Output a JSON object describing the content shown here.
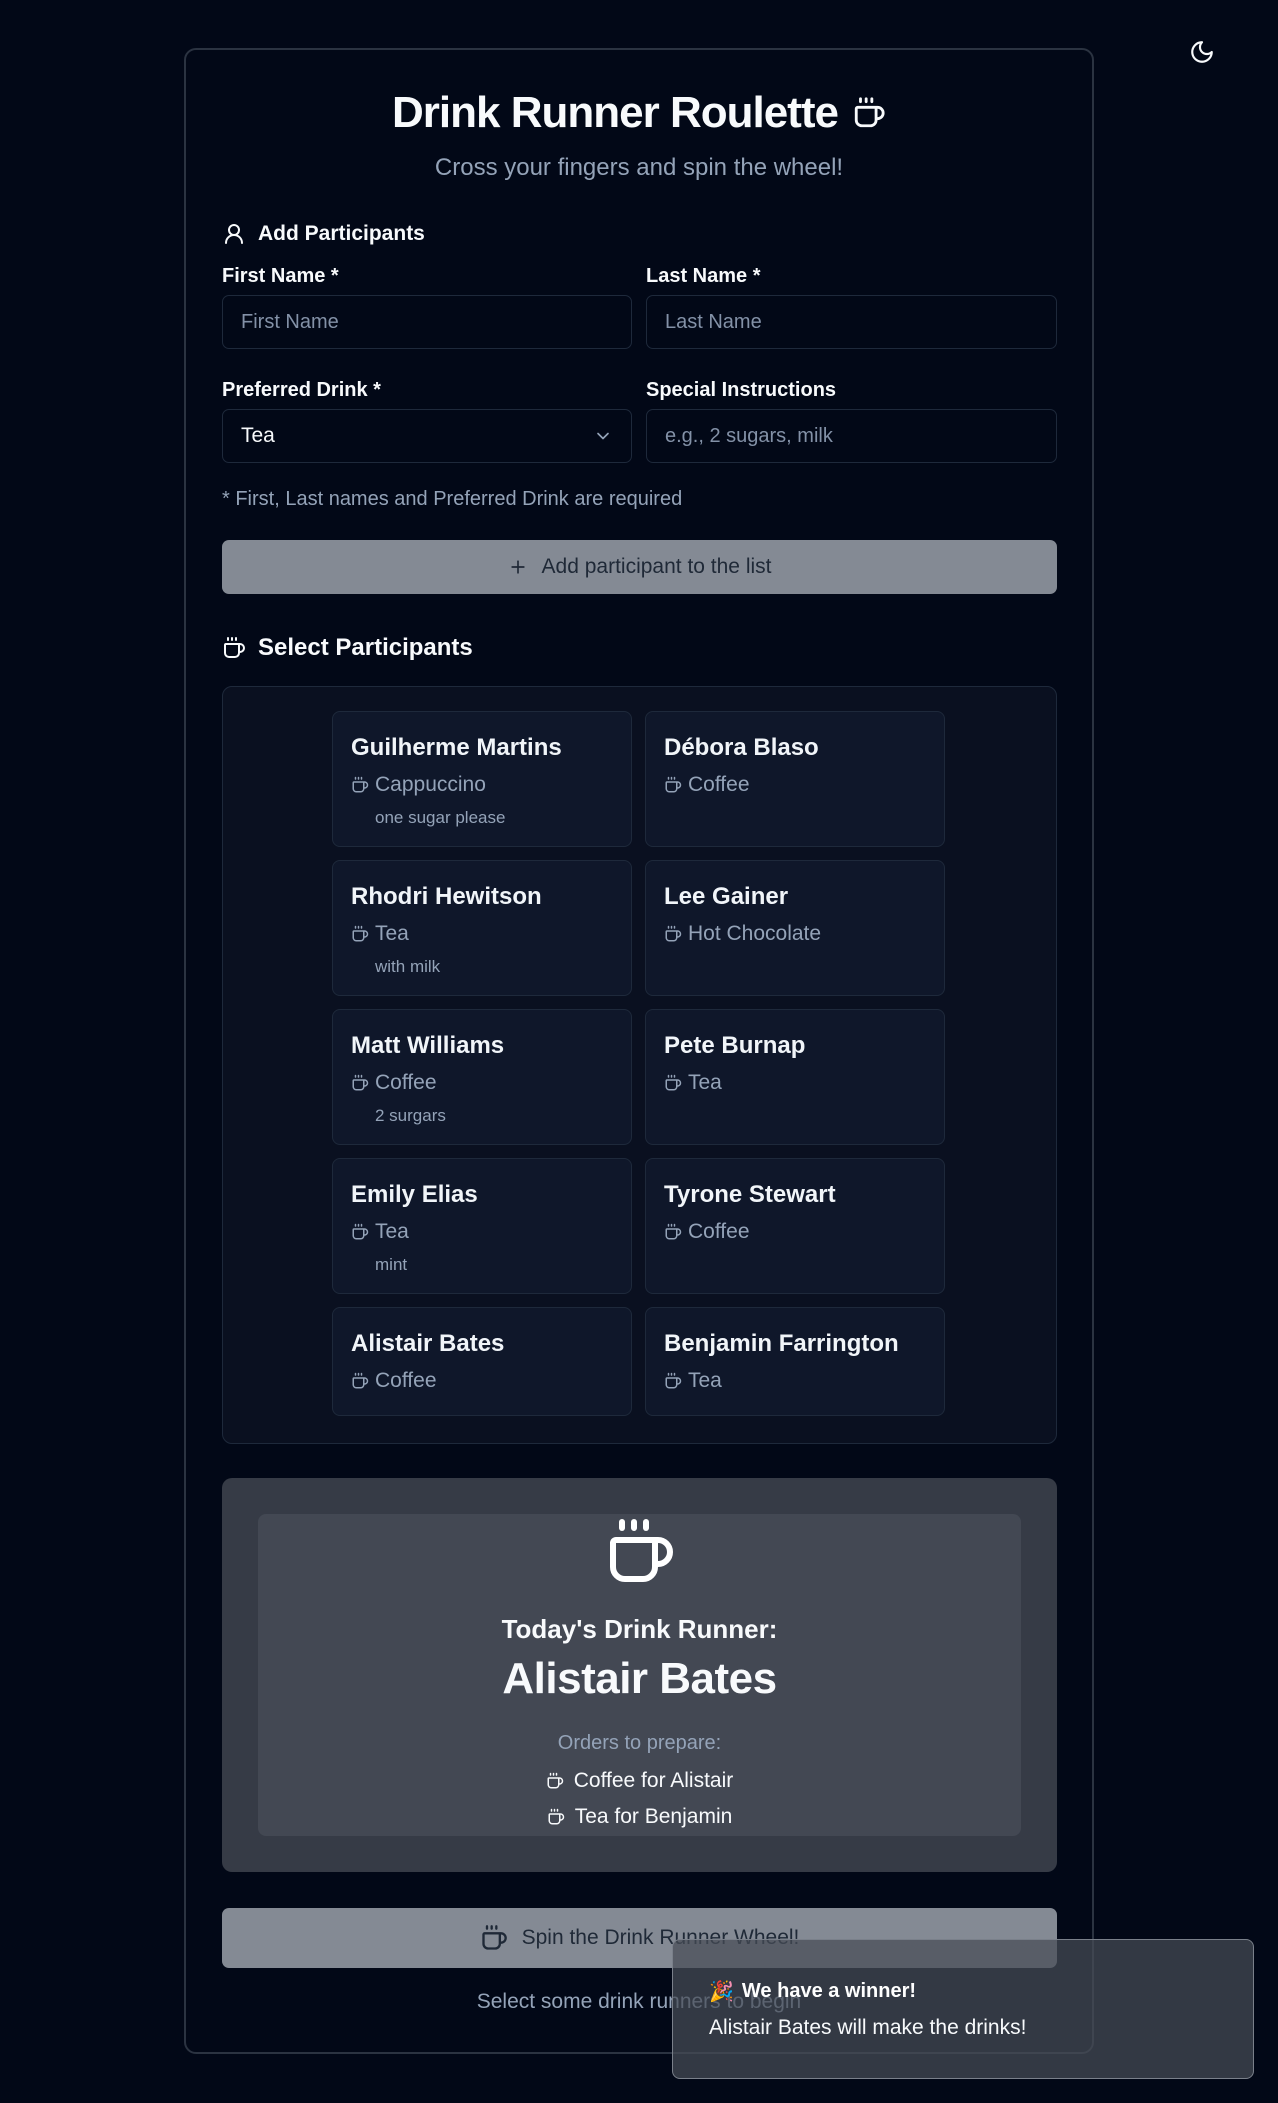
{
  "theme_toggle": {
    "icon": "moon-icon"
  },
  "header": {
    "title": "Drink Runner Roulette",
    "subtitle": "Cross your fingers and spin the wheel!"
  },
  "add_section": {
    "heading": "Add Participants",
    "first_name_label": "First Name *",
    "first_name_placeholder": "First Name",
    "first_name_value": "",
    "last_name_label": "Last Name *",
    "last_name_placeholder": "Last Name",
    "last_name_value": "",
    "drink_label": "Preferred Drink *",
    "drink_selected": "Tea",
    "instructions_label": "Special Instructions",
    "instructions_placeholder": "e.g., 2 sugars, milk",
    "instructions_value": "",
    "required_note": "* First, Last names and Preferred Drink are required",
    "add_button": "Add participant to the list"
  },
  "select_section": {
    "heading": "Select Participants",
    "participants": [
      {
        "name": "Guilherme Martins",
        "drink": "Cappuccino",
        "note": "one sugar please"
      },
      {
        "name": "Débora Blaso",
        "drink": "Coffee",
        "note": ""
      },
      {
        "name": "Rhodri Hewitson",
        "drink": "Tea",
        "note": "with milk"
      },
      {
        "name": "Lee Gainer",
        "drink": "Hot Chocolate",
        "note": ""
      },
      {
        "name": "Matt Williams",
        "drink": "Coffee",
        "note": "2 surgars"
      },
      {
        "name": "Pete Burnap",
        "drink": "Tea",
        "note": ""
      },
      {
        "name": "Emily Elias",
        "drink": "Tea",
        "note": "mint"
      },
      {
        "name": "Tyrone Stewart",
        "drink": "Coffee",
        "note": ""
      },
      {
        "name": "Alistair Bates",
        "drink": "Coffee",
        "note": ""
      },
      {
        "name": "Benjamin Farrington",
        "drink": "Tea",
        "note": ""
      }
    ]
  },
  "winner": {
    "label": "Today's Drink Runner:",
    "name": "Alistair Bates",
    "orders_label": "Orders to prepare:",
    "orders": [
      "Coffee for Alistair",
      "Tea for Benjamin"
    ]
  },
  "spin_button": "Spin the Drink Runner Wheel!",
  "hint": "Select some drink runners to begin",
  "toast": {
    "title": "We have a winner!",
    "message": "Alistair Bates will make the drinks!"
  },
  "colors": {
    "background": "#020817",
    "muted_text": "#94a3b8",
    "button_gray": "#848a94",
    "winner_panel": "#363b46"
  }
}
